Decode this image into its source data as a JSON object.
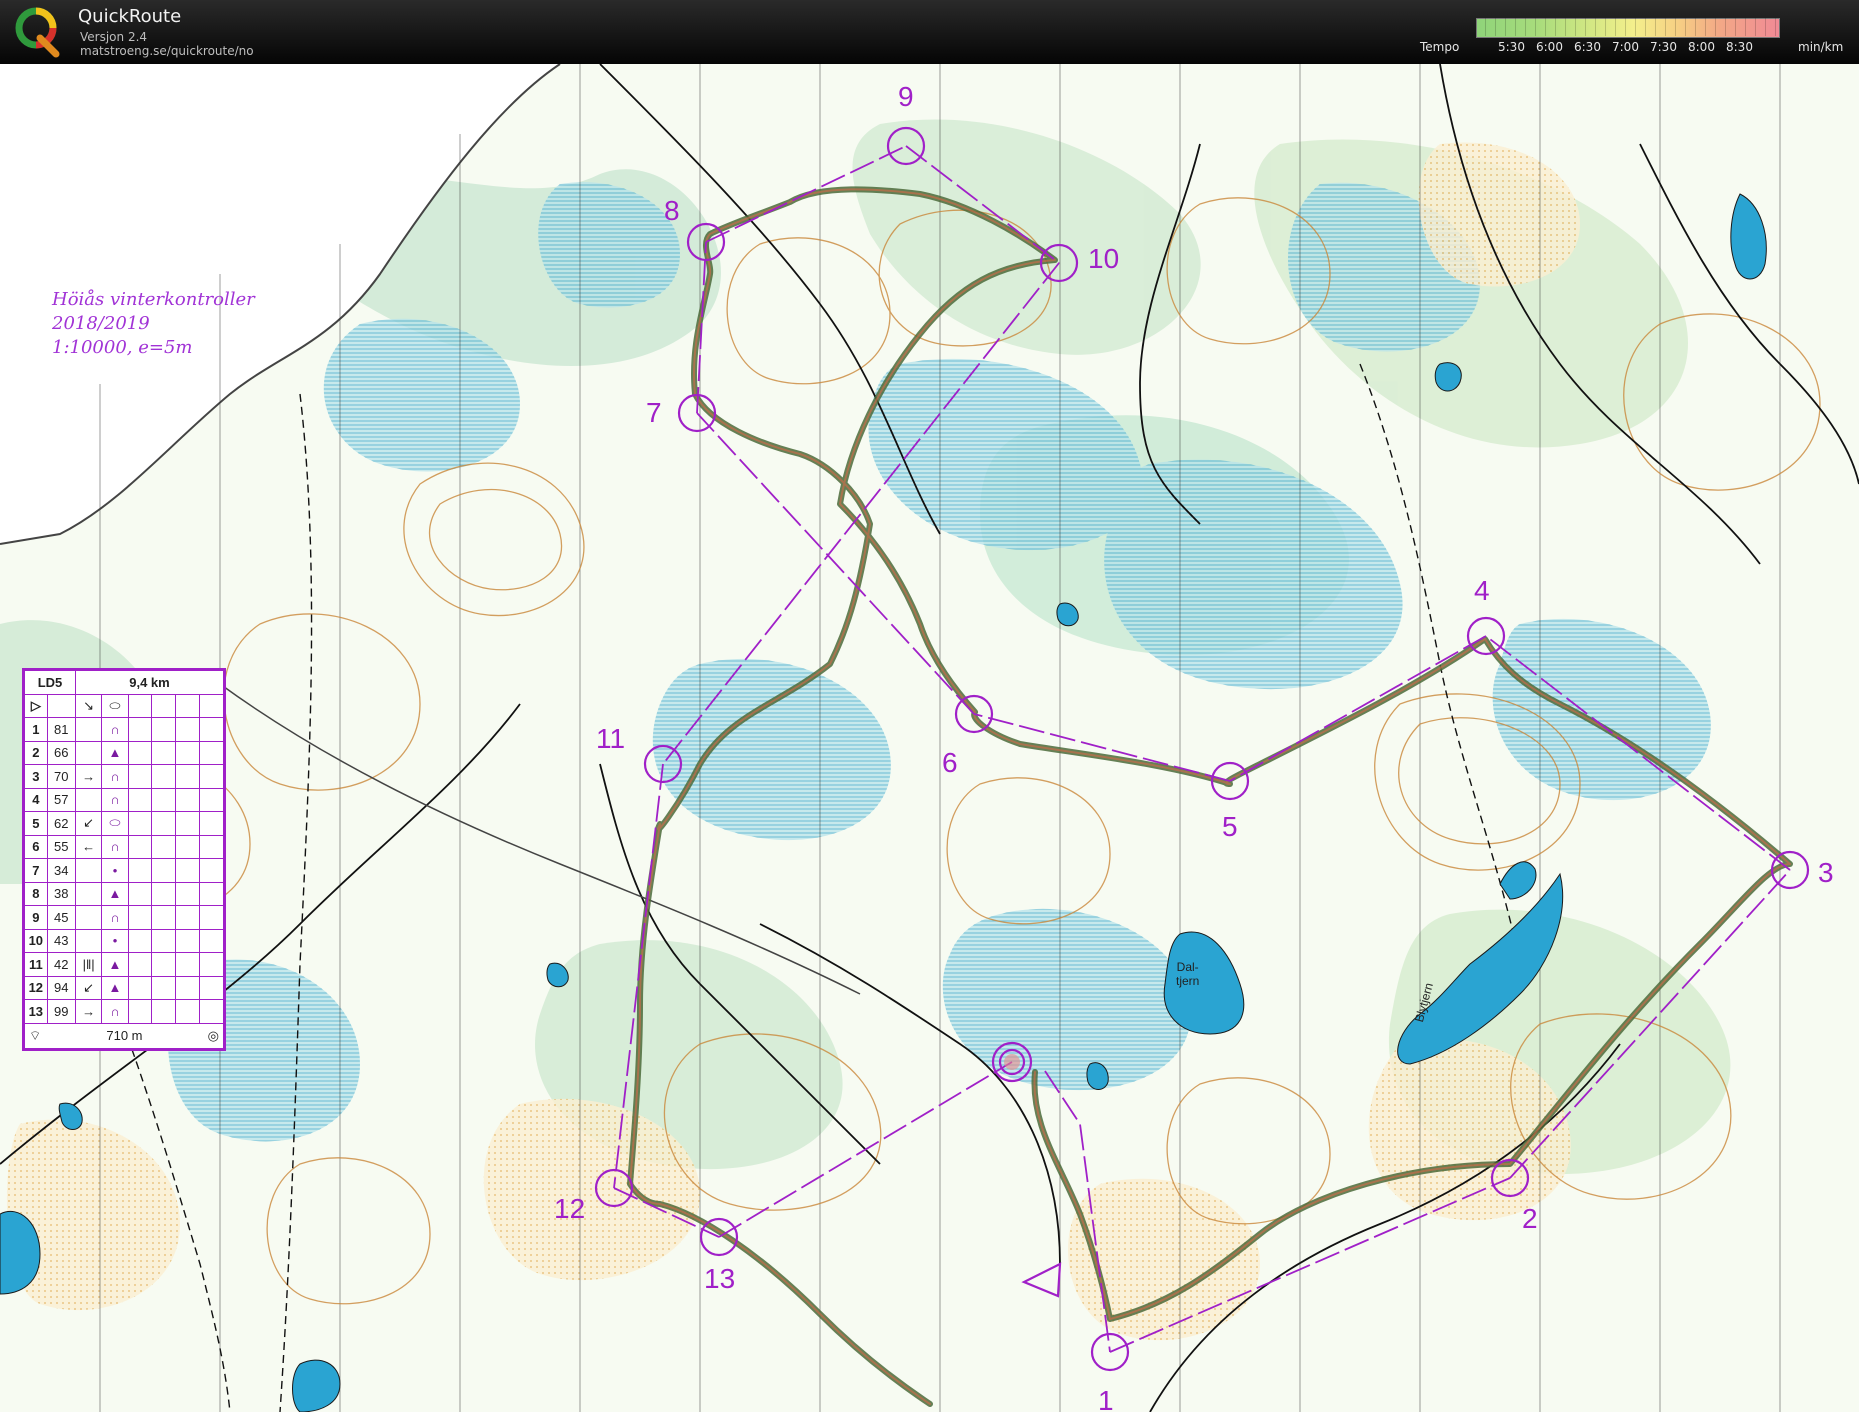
{
  "app": {
    "title": "QuickRoute",
    "version": "Versjon 2.4",
    "url": "matstroeng.se/quickroute/no"
  },
  "tempo": {
    "label": "Tempo",
    "unit": "min/km",
    "ticks": [
      "5:30",
      "6:00",
      "6:30",
      "7:00",
      "7:30",
      "8:00",
      "8:30"
    ]
  },
  "map": {
    "note": {
      "line1": "Höiås vinterkontroller",
      "line2": "2018/2019",
      "line3": "1:10000,  e=5m"
    },
    "lake_labels": [
      "Dal-",
      "tjern",
      "Blytjern"
    ],
    "course_color": "#a020c8",
    "route_color": "#5a7a3a",
    "controls": [
      {
        "label": "1"
      },
      {
        "label": "2"
      },
      {
        "label": "3"
      },
      {
        "label": "4"
      },
      {
        "label": "5"
      },
      {
        "label": "6"
      },
      {
        "label": "7"
      },
      {
        "label": "8"
      },
      {
        "label": "9"
      },
      {
        "label": "10"
      },
      {
        "label": "11"
      },
      {
        "label": "12"
      },
      {
        "label": "13"
      }
    ]
  },
  "card": {
    "course": "LD5",
    "length": "9,4 km",
    "finish_length": "710 m",
    "rows": [
      {
        "num": "1",
        "code": "81",
        "dir": "",
        "sym": "∩"
      },
      {
        "num": "2",
        "code": "66",
        "dir": "",
        "sym": "▲"
      },
      {
        "num": "3",
        "code": "70",
        "dir": "→",
        "sym": "∩"
      },
      {
        "num": "4",
        "code": "57",
        "dir": "",
        "sym": "∩"
      },
      {
        "num": "5",
        "code": "62",
        "dir": "↙",
        "sym": "⬭"
      },
      {
        "num": "6",
        "code": "55",
        "dir": "←",
        "sym": "∩"
      },
      {
        "num": "7",
        "code": "34",
        "dir": "",
        "sym": "•"
      },
      {
        "num": "8",
        "code": "38",
        "dir": "",
        "sym": "▲"
      },
      {
        "num": "9",
        "code": "45",
        "dir": "",
        "sym": "∩"
      },
      {
        "num": "10",
        "code": "43",
        "dir": "",
        "sym": "•"
      },
      {
        "num": "11",
        "code": "42",
        "dir": "|‖|",
        "sym": "▲"
      },
      {
        "num": "12",
        "code": "94",
        "dir": "↙",
        "sym": "▲"
      },
      {
        "num": "13",
        "code": "99",
        "dir": "→",
        "sym": "∩"
      }
    ]
  }
}
